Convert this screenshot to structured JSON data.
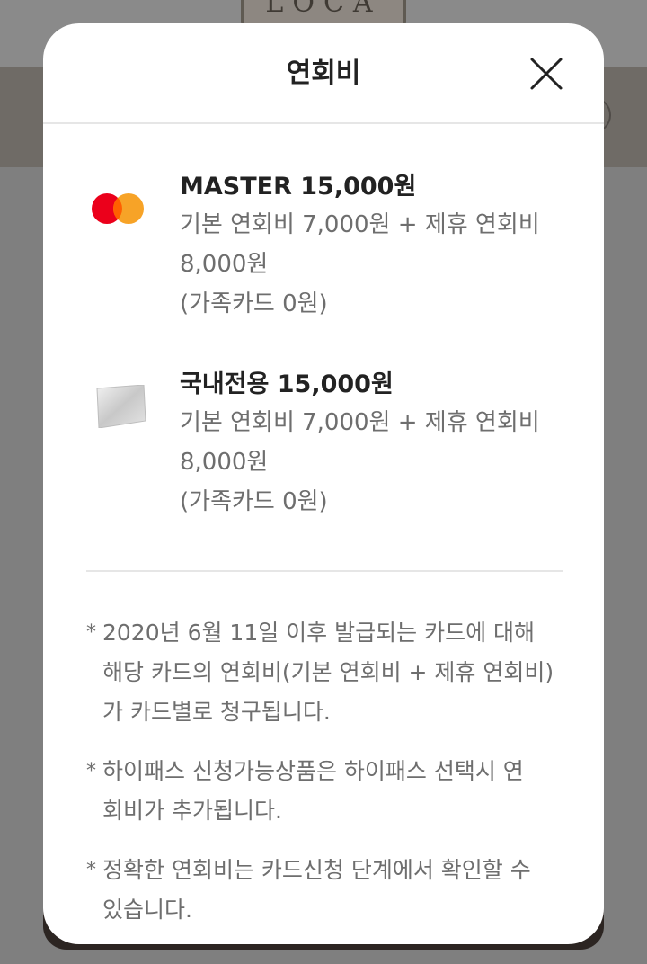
{
  "background": {
    "logo_text": "LOCA"
  },
  "modal": {
    "title": "연회비",
    "close_icon": "close-icon"
  },
  "cards": [
    {
      "icon": "mastercard-icon",
      "title": "MASTER 15,000원",
      "desc_lines": [
        "기본 연회비 7,000원 + 제휴 연회비",
        "8,000원",
        "(가족카드 0원)"
      ]
    },
    {
      "icon": "domestic-card-icon",
      "title": "국내전용 15,000원",
      "desc_lines": [
        "기본 연회비 7,000원 + 제휴 연회비",
        "8,000원",
        "(가족카드 0원)"
      ]
    }
  ],
  "notes": [
    {
      "marker": "*",
      "lines": [
        "2020년 6월 11일 이후 발급되는 카드에 대해",
        "해당 카드의 연회비(기본 연회비 + 제휴 연회비)",
        "가 카드별로 청구됩니다."
      ]
    },
    {
      "marker": "*",
      "lines": [
        "하이패스 신청가능상품은 하이패스 선택시 연",
        "회비가 추가됩니다."
      ]
    },
    {
      "marker": "*",
      "lines": [
        "정확한 연회비는 카드신청 단계에서 확인할 수",
        "있습니다."
      ]
    }
  ],
  "colors": {
    "mastercard_red": "#eb001b",
    "mastercard_orange": "#f79e1b",
    "overlay": "#7f7f7f"
  }
}
